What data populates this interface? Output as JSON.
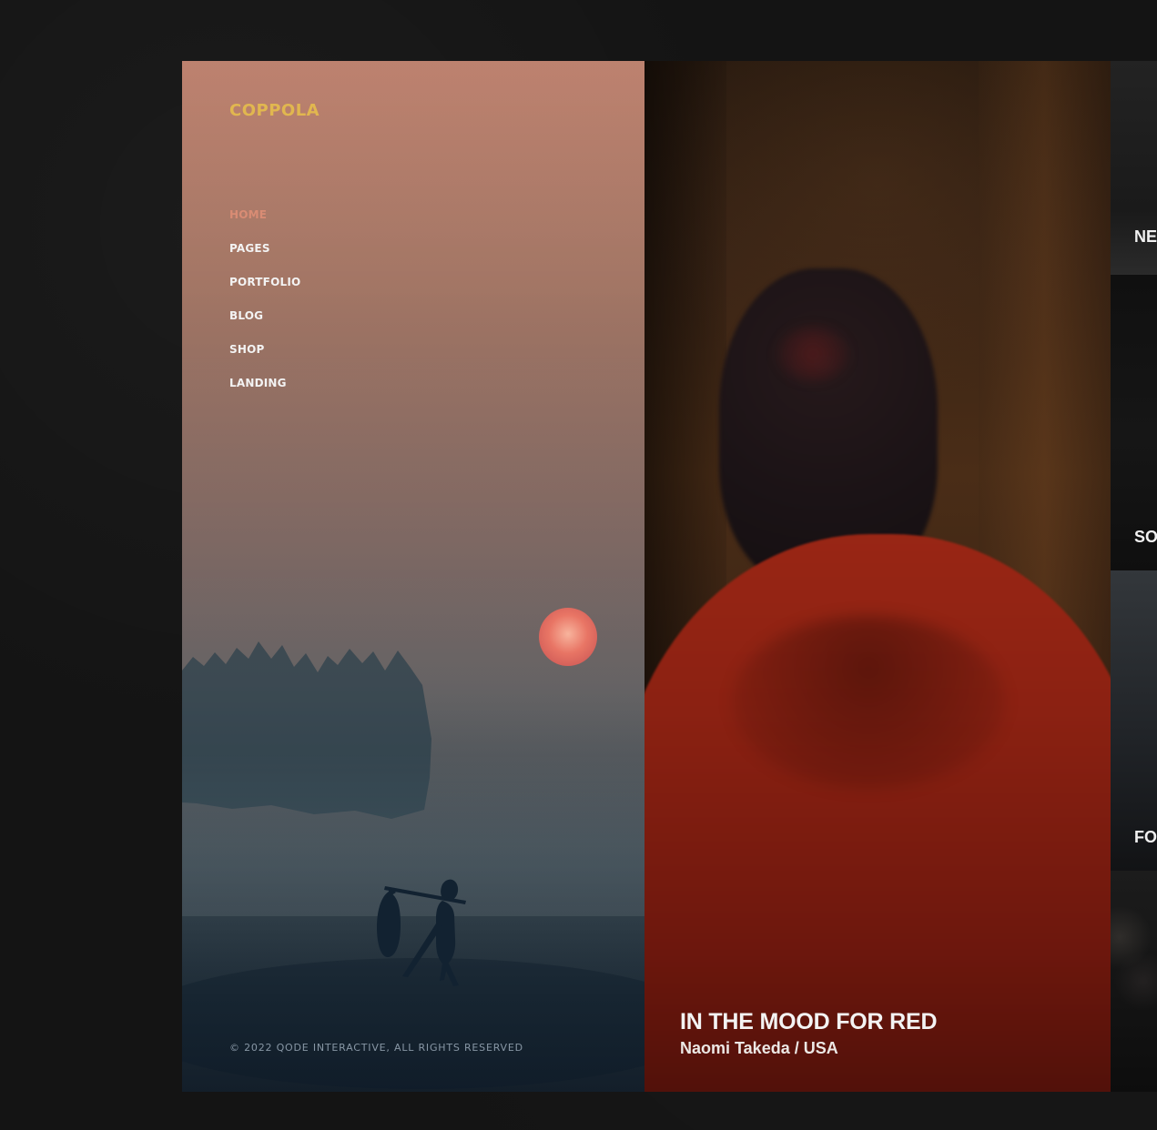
{
  "brand": "COPPOLA",
  "navigation": [
    {
      "label": "HOME",
      "active": true
    },
    {
      "label": "PAGES",
      "active": false
    },
    {
      "label": "PORTFOLIO",
      "active": false
    },
    {
      "label": "BLOG",
      "active": false
    },
    {
      "label": "SHOP",
      "active": false
    },
    {
      "label": "LANDING",
      "active": false
    }
  ],
  "footer": {
    "copyright": "© 2022 QODE INTERACTIVE, ALL RIGHTS RESERVED"
  },
  "featured": {
    "title": "IN THE MOOD FOR RED",
    "subtitle": "Naomi Takeda / USA"
  },
  "side_strip": [
    {
      "label": "NE"
    },
    {
      "label": "SO"
    },
    {
      "label": "FO"
    }
  ],
  "colors": {
    "background": "#141414",
    "brand": "#e1b74f",
    "active_nav": "#d98c74",
    "nav": "#f3f3f3"
  }
}
